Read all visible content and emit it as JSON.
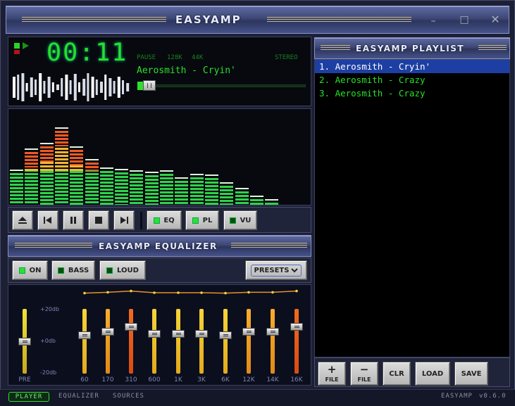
{
  "app": {
    "title": "EASYAMP",
    "version": "v0.6.0",
    "window_buttons": [
      "minimize",
      "maximize",
      "close"
    ]
  },
  "player": {
    "time": "00:11",
    "state": "PAUSE",
    "bitrate": "128K",
    "samplerate": "44K",
    "mode": "STEREO",
    "track": "Aerosmith - Cryin'",
    "seek_progress": 0.02,
    "controls": [
      "eject",
      "previous",
      "pause",
      "stop",
      "next"
    ],
    "toggles": [
      {
        "label": "EQ",
        "on": true
      },
      {
        "label": "PL",
        "on": true
      },
      {
        "label": "VU",
        "on": false
      }
    ]
  },
  "equalizer": {
    "title": "EASYAMP EQUALIZER",
    "on_label": "ON",
    "bass_label": "BASS",
    "loud_label": "LOUD",
    "presets_label": "PRESETS",
    "scale": {
      "top": "+20db",
      "mid": "+0db",
      "bottom": "-20db"
    },
    "preamp": {
      "label": "PRE",
      "value": 0
    },
    "bands": [
      {
        "label": "60",
        "value": 4
      },
      {
        "label": "170",
        "value": 6
      },
      {
        "label": "310",
        "value": 9
      },
      {
        "label": "600",
        "value": 5
      },
      {
        "label": "1K",
        "value": 5
      },
      {
        "label": "3K",
        "value": 5
      },
      {
        "label": "6K",
        "value": 4
      },
      {
        "label": "12K",
        "value": 6
      },
      {
        "label": "14K",
        "value": 6
      },
      {
        "label": "16K",
        "value": 9
      }
    ]
  },
  "playlist": {
    "title": "EASYAMP PLAYLIST",
    "items": [
      "1. Aerosmith - Cryin'",
      "2. Aerosmith - Crazy",
      "3. Aerosmith - Crazy"
    ],
    "selected": 0,
    "buttons": [
      {
        "symbol": "+",
        "label": "FILE"
      },
      {
        "symbol": "−",
        "label": "FILE"
      },
      {
        "symbol": "",
        "label": "CLR"
      },
      {
        "symbol": "",
        "label": "LOAD"
      },
      {
        "symbol": "",
        "label": "SAVE"
      }
    ]
  },
  "tabs": [
    "PLAYER",
    "EQUALIZER",
    "SOURCES"
  ],
  "active_tab": 0,
  "spectrum": [
    0.33,
    0.55,
    0.61,
    0.77,
    0.57,
    0.44,
    0.35,
    0.34,
    0.32,
    0.31,
    0.32,
    0.25,
    0.29,
    0.28,
    0.2,
    0.14,
    0.06,
    0.02
  ]
}
